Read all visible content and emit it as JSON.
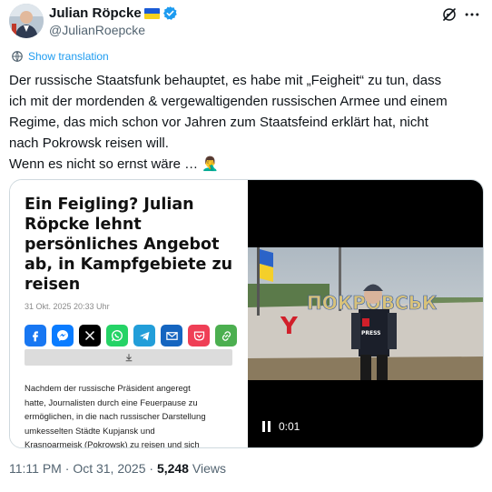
{
  "author": {
    "display_name": "Julian Röpcke",
    "handle": "@JulianRoepcke"
  },
  "translate_label": "Show translation",
  "tweet": {
    "lines": [
      "Der russische Staatsfunk behauptet, es habe mit „Feigheit“ zu tun, dass",
      "ich mit der mordenden & vergewaltigenden russischen Armee und einem",
      "Regime, das mich schon vor Jahren zum Staatsfeind erklärt hat, nicht",
      "nach Pokrowsk reisen will.",
      "Wenn es nicht so ernst wäre … 🤦‍♂️"
    ]
  },
  "article": {
    "title": "Ein Feigling? Julian Röpcke lehnt persönliches Angebot ab, in Kampfgebiete zu reisen",
    "date": "31 Okt. 2025 20:33 Uhr",
    "share_icons": [
      "facebook-icon",
      "messenger-icon",
      "x-icon",
      "whatsapp-icon",
      "telegram-icon",
      "email-icon",
      "pocket-icon",
      "link-icon"
    ],
    "body_lines": [
      "Nachdem der russische Präsident angeregt",
      "hatte, Journalisten durch eine Feuerpause zu",
      "ermöglichen, in die nach russischer Darstellung",
      "umkesselten Städte Kupjansk und",
      "Krasnoarmejsk (Pokrowsk) zu reisen und sich"
    ]
  },
  "video": {
    "sign_text": "ПОКРОВСЬК",
    "press_text": "PRESS",
    "time": "0:01"
  },
  "footer": {
    "time": "11:11 PM",
    "separator": "·",
    "date": "Oct 31, 2025",
    "views_count": "5,248",
    "views_label": "Views"
  },
  "colors": {
    "accent": "#1d9bf0",
    "verified": "#1d9bf0",
    "secondary_text": "#536471"
  }
}
